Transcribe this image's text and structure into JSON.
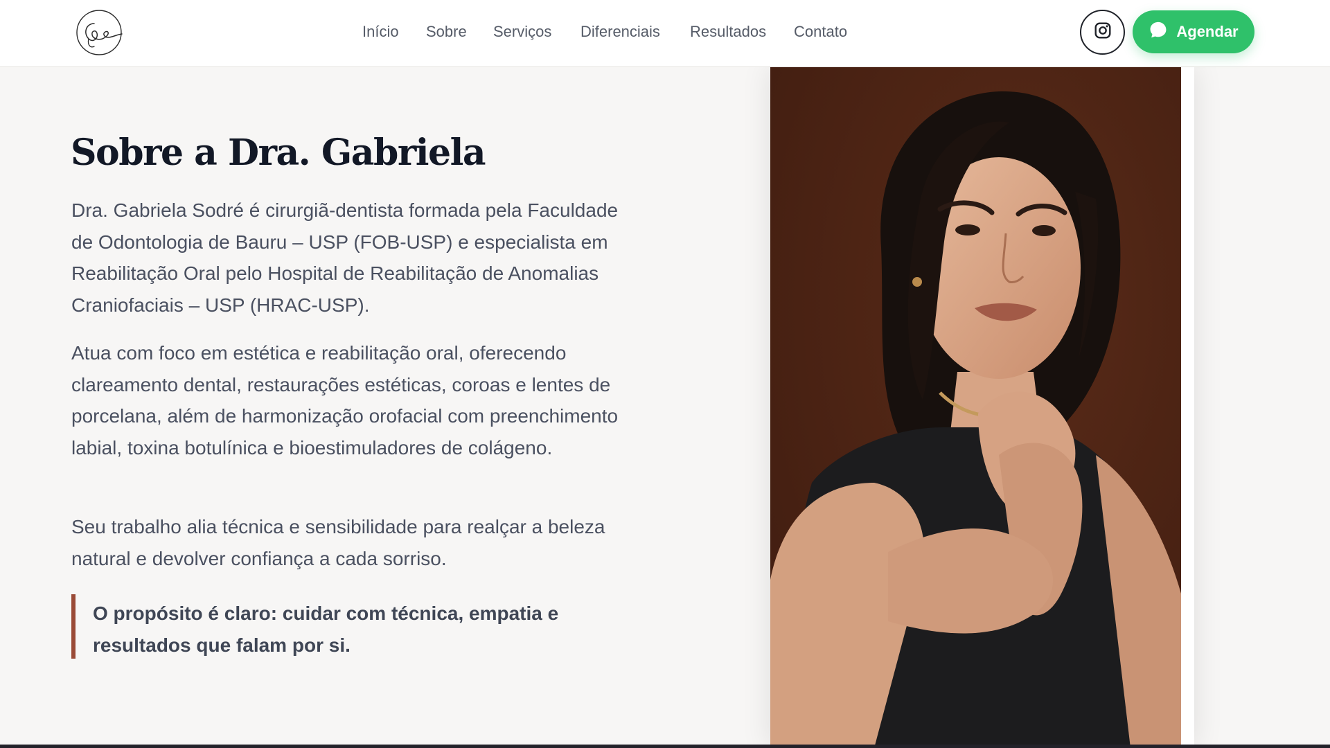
{
  "header": {
    "nav": [
      "Início",
      "Sobre",
      "Serviços",
      "Diferenciais",
      "Resultados",
      "Contato"
    ],
    "cta_label": "Agendar",
    "cta_color": "#2fc16a",
    "instagram_icon": "instagram-icon",
    "cta_icon": "chat-bubble-icon"
  },
  "about": {
    "title": "Sobre a Dra. Gabriela",
    "paragraphs": [
      "Dra. Gabriela Sodré é cirurgiã-dentista formada pela Faculdade de Odontologia de Bauru – USP (FOB-USP) e especialista em Reabilitação Oral pelo Hospital de Reabilitação de Anomalias Craniofaciais – USP (HRAC-USP).",
      "Atua com foco em estética e reabilitação oral, oferecendo clareamento dental, restaurações estéticas, coroas e lentes de porcelana, além de harmonização orofacial com preenchimento labial, toxina botulínica e bioestimuladores de colágeno.",
      "Seu trabalho alia técnica e sensibilidade para realçar a beleza natural e devolver confiança a cada sorriso."
    ],
    "quote": "O propósito é claro: cuidar com técnica, empatia e resultados que falam por si.",
    "quote_accent": "#9a4a36"
  },
  "photo": {
    "background": "#4e2516"
  }
}
